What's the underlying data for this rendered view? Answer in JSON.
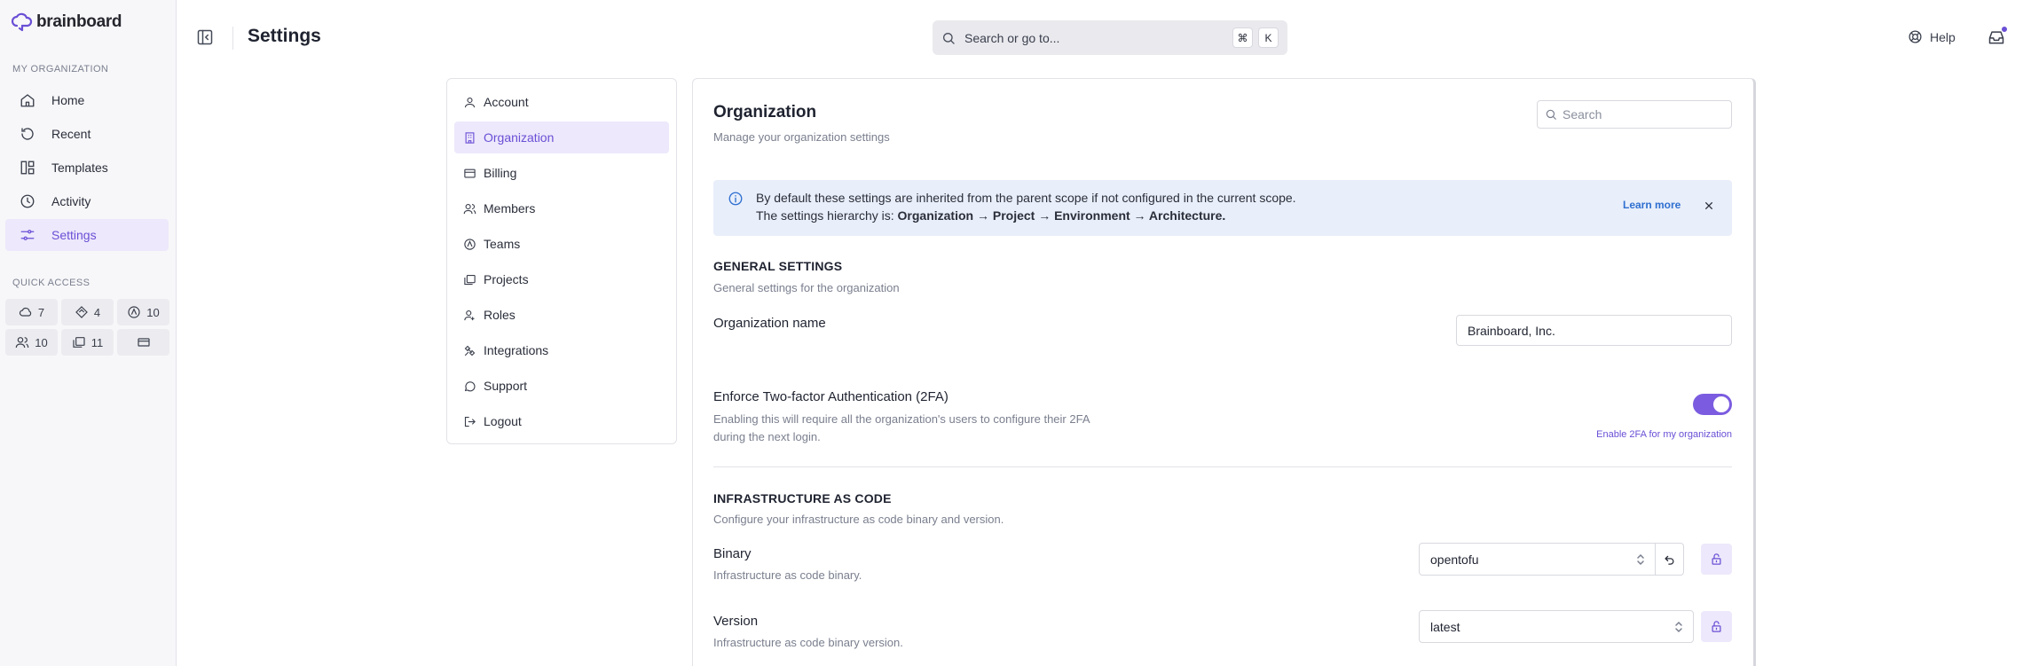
{
  "app": {
    "brand": "brainboard",
    "page_title": "Settings"
  },
  "colors": {
    "accent": "#7b5ce0",
    "accent_bg": "#ede8fb",
    "info_bg": "#e8eefa",
    "link": "#2f6fd0"
  },
  "sidebar": {
    "section_label": "MY ORGANIZATION",
    "items": [
      {
        "label": "Home",
        "icon": "home-icon"
      },
      {
        "label": "Recent",
        "icon": "history-icon"
      },
      {
        "label": "Templates",
        "icon": "templates-icon"
      },
      {
        "label": "Activity",
        "icon": "clock-icon"
      },
      {
        "label": "Settings",
        "icon": "sliders-icon",
        "active": true
      }
    ],
    "quick_access_label": "QUICK ACCESS",
    "quick_access": [
      {
        "icon": "cloud-icon",
        "count": "7"
      },
      {
        "icon": "diamond-icon",
        "count": "4"
      },
      {
        "icon": "badge-icon",
        "count": "10"
      },
      {
        "icon": "users-icon",
        "count": "10"
      },
      {
        "icon": "folders-icon",
        "count": "11"
      },
      {
        "icon": "card-icon",
        "count": ""
      }
    ]
  },
  "header": {
    "search_placeholder": "Search or go to...",
    "shortcut_keys": [
      "⌘",
      "K"
    ],
    "help_label": "Help"
  },
  "settings_nav": {
    "items": [
      {
        "label": "Account",
        "icon": "user-icon"
      },
      {
        "label": "Organization",
        "icon": "building-icon",
        "active": true
      },
      {
        "label": "Billing",
        "icon": "credit-card-icon"
      },
      {
        "label": "Members",
        "icon": "members-icon"
      },
      {
        "label": "Teams",
        "icon": "teams-icon"
      },
      {
        "label": "Projects",
        "icon": "projects-icon"
      },
      {
        "label": "Roles",
        "icon": "roles-icon"
      },
      {
        "label": "Integrations",
        "icon": "integrations-icon"
      },
      {
        "label": "Support",
        "icon": "chat-icon"
      },
      {
        "label": "Logout",
        "icon": "logout-icon"
      }
    ]
  },
  "main": {
    "title": "Organization",
    "subtitle": "Manage your organization settings",
    "search_placeholder": "Search",
    "info": {
      "line1": "By default these settings are inherited from the parent scope if not configured in the current scope.",
      "line2_prefix": "The settings hierarchy is: ",
      "line2_bold": "Organization → Project → Environment → Architecture.",
      "learn_more": "Learn more"
    },
    "general": {
      "title": "GENERAL SETTINGS",
      "subtitle": "General settings for the organization",
      "org_name_label": "Organization name",
      "org_name_value": "Brainboard, Inc.",
      "twofa_label": "Enforce Two-factor Authentication (2FA)",
      "twofa_desc": "Enabling this will require all the organization's users to configure their 2FA during the next login.",
      "twofa_enabled": true,
      "twofa_caption": "Enable 2FA for my organization"
    },
    "iac": {
      "title": "INFRASTRUCTURE AS CODE",
      "subtitle": "Configure your infrastructure as code binary and version.",
      "binary_label": "Binary",
      "binary_desc": "Infrastructure as code binary.",
      "binary_value": "opentofu",
      "version_label": "Version",
      "version_desc": "Infrastructure as code binary version.",
      "version_value": "latest"
    }
  }
}
